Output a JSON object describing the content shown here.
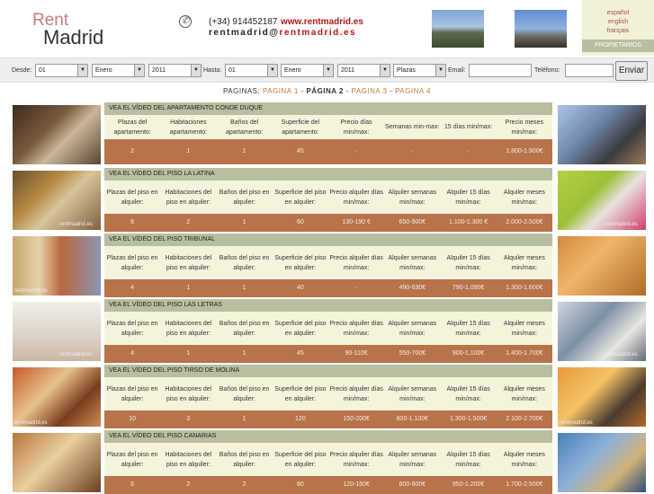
{
  "header": {
    "logo_rent": "Rent",
    "logo_madrid": "Madrid",
    "phone_icon": "phone-icon",
    "phone": "(+34) 914452187",
    "site": "www.rentmadrid.es",
    "email_user": "rentmadrid@",
    "email_domain": "rentmadrid.es"
  },
  "languages": [
    "español",
    "english",
    "français"
  ],
  "owners_label": "PROPIETARIOS",
  "search": {
    "desde_label": "Desde:",
    "desde_day": "01",
    "desde_month": "Enero",
    "desde_year": "2011",
    "hasta_label": "Hasta:",
    "hasta_day": "01",
    "hasta_month": "Enero",
    "hasta_year": "2011",
    "plazas": "Plazas",
    "email_label": "Email:",
    "telefono_label": "Teléfono:",
    "send_label": "Enviar"
  },
  "pager": {
    "label": "PAGINAS:",
    "p1": "PAGINA 1",
    "sep1": " - ",
    "p2": "PÁGINA 2",
    "sep2": " - ",
    "p3": "PAGINA 3",
    "sep3": " - ",
    "p4": "PAGINA 4"
  },
  "listings": [
    {
      "title": "VEA EL VÍDEO DEL APARTAMENTO CONDE DUQUE",
      "headers": [
        "Plazas del apartamento:",
        "Habitaciones apartamento:",
        "Baños del apartamento:",
        "Superficie del apartamento:",
        "Precio días min/max:",
        "Semanas min-max:",
        "15 días min/max:",
        "Precio meses min/max:"
      ],
      "values": [
        "2",
        "1",
        "1",
        "45",
        "-",
        "-",
        "-",
        "1.800-1.900€"
      ]
    },
    {
      "title": "VEA EL VÍDEO DEL PISO LA LATINA",
      "headers": [
        "Plazas del piso en alquiler:",
        "Habitaciones del piso en alquiler:",
        "Baños del piso en alquiler:",
        "Superficie del piso en alquiler:",
        "Precio alquiler días min/max:",
        "Alquiler semanas min/max:",
        "Alquiler 15 días min/max:",
        "Alquiler meses min/max:"
      ],
      "values": [
        "8",
        "2",
        "1",
        "60",
        "130-190 €",
        "650-900€",
        "1.100-1.300 €",
        "2.000-2.500€"
      ]
    },
    {
      "title": "VEA EL VÍDEO DEL PISO TRIBUNAL",
      "headers": [
        "Plazas del piso en alquiler:",
        "Habitaciones del piso en alquiler:",
        "Baños del piso en alquiler:",
        "Superficie del piso en alquiler:",
        "Precio alquiler días min/max:",
        "Alquiler semanas min/max:",
        "Alquiler 15 días min/max:",
        "Alquiler meses min/max:"
      ],
      "values": [
        "4",
        "1",
        "1",
        "40",
        "-",
        "490-630€",
        "790-1.090€",
        "1.300-1.600€"
      ]
    },
    {
      "title": "VEA EL VÍDEO DEL PISO LAS LETRAS",
      "headers": [
        "Plazas del piso en alquiler:",
        "Habitaciones del piso en alquiler:",
        "Baños del piso en alquiler:",
        "Superficie del piso en alquiler:",
        "Precio alquiler días min/max:",
        "Alquiler semanas min/max:",
        "Alquiler 15 días min/max:",
        "Alquiler meses min/max:"
      ],
      "values": [
        "4",
        "1",
        "1",
        "45",
        "90-110€",
        "550-700€",
        "900-1.100€",
        "1.400-1.700€"
      ]
    },
    {
      "title": "VEA EL VÍDEO DEL PISO TIRSO DE MOLINA",
      "headers": [
        "Plazas del piso en alquiler:",
        "Habitaciones del piso en alquiler:",
        "Baños del piso en alquiler:",
        "Superficie del piso en alquiler:",
        "Precio alquiler días min/max:",
        "Alquiler semanas min/max:",
        "Alquiler 15 días min/max:",
        "Alquiler meses min/max:"
      ],
      "values": [
        "10",
        "3",
        "1",
        "120",
        "150-200€",
        "800-1.100€",
        "1.300-1.500€",
        "2.100-2.700€"
      ]
    },
    {
      "title": "VEA EL VÍDEO DEL PISO CANARIAS",
      "headers": [
        "Plazas del piso en alquiler:",
        "Habitaciones del piso en alquiler:",
        "Baños del piso en alquiler:",
        "Superficie del piso en alquiler:",
        "Precio alquiler días min/max:",
        "Alquiler semanas min/max:",
        "Alquiler 15 días min/max:",
        "Alquiler meses min/max:"
      ],
      "values": [
        "6",
        "2",
        "2",
        "80",
        "120-160€",
        "600-800€",
        "950-1.200€",
        "1.700-2.500€"
      ]
    }
  ],
  "watermark": "rentmadrid.es"
}
